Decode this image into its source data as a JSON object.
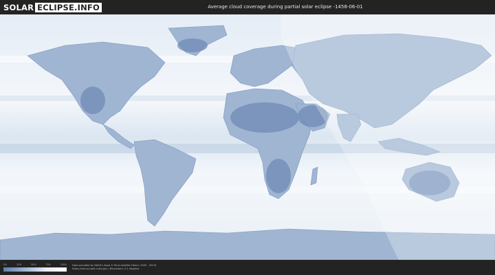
{
  "header": {
    "logo_part1": "SOLAR",
    "logo_part2": "ECLIPSE.INFO",
    "title": "Average cloud coverage during partial solar eclipse -1458-06-01"
  },
  "legend": {
    "ticks": [
      "0%",
      "25%",
      "50%",
      "75%",
      "100%"
    ],
    "gradient_colors": [
      "#5f7fab",
      "#9fb5d0",
      "#e6edf5",
      "#ffffff"
    ]
  },
  "footer": {
    "credit_line1": "Data provided by NASA's Aqua & Terra satellite (Years: 2000 - 2019)",
    "credit_line2": "https://neo.sci.gsfc.nasa.gov | Resolution: 0.1 degrees"
  },
  "map": {
    "ocean_color": "#eef3f8",
    "land_color": "#7d97bf",
    "eclipse_overlay_color": "#ffffff"
  }
}
